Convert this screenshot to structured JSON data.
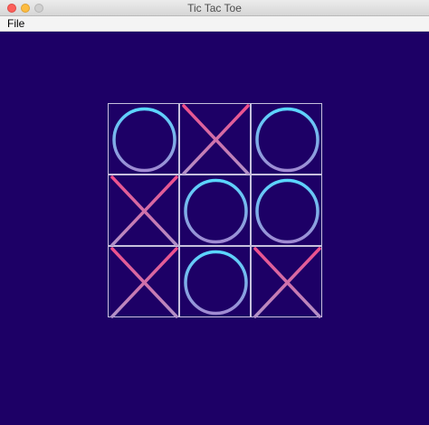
{
  "window": {
    "title": "Tic Tac Toe",
    "background": "#1d0066"
  },
  "menubar": {
    "items": [
      {
        "label": "File"
      }
    ]
  },
  "board": {
    "rows": 3,
    "cols": 3,
    "grid_color": "#c7c0dd",
    "cells": [
      [
        "O",
        "X",
        "O"
      ],
      [
        "X",
        "O",
        "O"
      ],
      [
        "X",
        "O",
        "X"
      ]
    ],
    "o_colors": {
      "top": "#5ad7ff",
      "bottom": "#a08ad2"
    },
    "x_colors": {
      "top": "#f04e8a",
      "bottom": "#b192c8"
    }
  }
}
